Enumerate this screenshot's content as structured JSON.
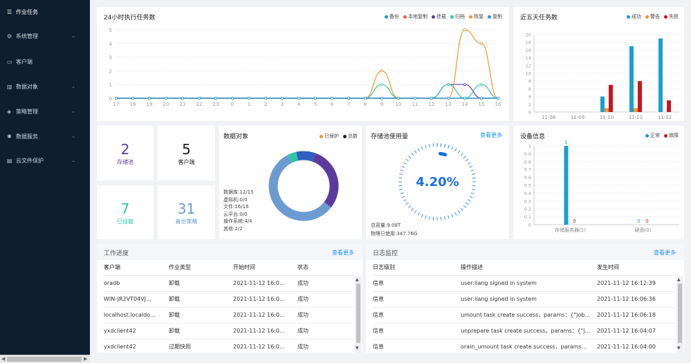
{
  "sidebar": {
    "items": [
      {
        "label": "作业任务",
        "icon": "list-icon"
      },
      {
        "label": "系统管理",
        "icon": "gear-icon"
      },
      {
        "label": "客户端",
        "icon": "monitor-icon"
      },
      {
        "label": "数据对象",
        "icon": "chart-icon"
      },
      {
        "label": "策略管理",
        "icon": "stack-icon"
      },
      {
        "label": "数据服务",
        "icon": "asterisk-icon"
      },
      {
        "label": "云文件保护",
        "icon": "document-icon"
      }
    ]
  },
  "tasks24h": {
    "title": "24小时执行任务数",
    "legend": [
      {
        "name": "备份",
        "color": "#1a9fcf"
      },
      {
        "name": "本地复制",
        "color": "#e5604b"
      },
      {
        "name": "挂载",
        "color": "#5b3c9e"
      },
      {
        "name": "归档",
        "color": "#2ec7a5"
      },
      {
        "name": "恢复",
        "color": "#f0962f"
      },
      {
        "name": "复制",
        "color": "#1f9dd9"
      }
    ]
  },
  "chart_data": [
    {
      "type": "line",
      "title": "24小时执行任务数",
      "x": [
        "17",
        "18",
        "19",
        "20",
        "21",
        "22",
        "23",
        "0",
        "1",
        "2",
        "3",
        "4",
        "5",
        "6",
        "7",
        "8",
        "9",
        "10",
        "11",
        "12",
        "13",
        "14",
        "15",
        "16"
      ],
      "ylim": [
        0,
        5
      ],
      "yticks": [
        0,
        1,
        2,
        3,
        4,
        5
      ],
      "grid": true,
      "legend_position": "top-right",
      "series": [
        {
          "name": "备份",
          "color": "#1a9fcf",
          "values": [
            0,
            0,
            0,
            0,
            0,
            0,
            0,
            0,
            0,
            0,
            0,
            0,
            0,
            0,
            0,
            0,
            0,
            0,
            0,
            0,
            0,
            0,
            0,
            0
          ]
        },
        {
          "name": "本地复制",
          "color": "#e5604b",
          "values": [
            0,
            0,
            0,
            0,
            0,
            0,
            0,
            0,
            0,
            0,
            0,
            0,
            0,
            0,
            0,
            0,
            0,
            0,
            0,
            0,
            0,
            0,
            0,
            0
          ]
        },
        {
          "name": "挂载",
          "color": "#5b3c9e",
          "values": [
            0,
            0,
            0,
            0,
            0,
            0,
            0,
            0,
            0,
            0,
            0,
            0,
            0,
            0,
            0,
            0,
            0,
            0,
            0,
            0,
            1,
            1,
            0,
            0
          ]
        },
        {
          "name": "归档",
          "color": "#2ec7a5",
          "values": [
            0,
            0,
            0,
            0,
            0,
            0,
            0,
            0,
            0,
            0,
            0,
            0,
            0,
            0,
            0,
            0,
            1,
            0,
            0,
            0,
            1,
            0,
            1,
            0
          ]
        },
        {
          "name": "恢复",
          "color": "#f0962f",
          "values": [
            0,
            0,
            0,
            0,
            0,
            0,
            0,
            0,
            0,
            0,
            0,
            0,
            0,
            0,
            0,
            0,
            2,
            0,
            0,
            0,
            0,
            5,
            4,
            0
          ]
        },
        {
          "name": "复制",
          "color": "#1f9dd9",
          "values": [
            0,
            0,
            0,
            0,
            0,
            0,
            0,
            0,
            0,
            0,
            0,
            0,
            0,
            0,
            0,
            0,
            0,
            0,
            0,
            0,
            0,
            0,
            0,
            0
          ]
        }
      ]
    },
    {
      "type": "bar",
      "title": "近五天任务数",
      "categories": [
        "11-08",
        "11-09",
        "11-10",
        "11-11",
        "11-12"
      ],
      "ylim": [
        0,
        20
      ],
      "yticks": [
        0,
        2,
        4,
        6,
        8,
        10,
        12,
        14,
        16,
        18,
        20
      ],
      "grid": true,
      "legend_position": "top-right",
      "series": [
        {
          "name": "成功",
          "color": "#1a9fcf",
          "values": [
            0,
            0,
            4,
            17,
            19
          ]
        },
        {
          "name": "警告",
          "color": "#f0962f",
          "values": [
            0,
            0,
            1,
            1,
            0
          ]
        },
        {
          "name": "失败",
          "color": "#c8161d",
          "values": [
            0,
            0,
            7,
            8,
            3
          ]
        }
      ]
    },
    {
      "type": "pie",
      "title": "数据对象",
      "legend_position": "top-right",
      "series": [
        {
          "name": "已保护",
          "color": "#f0962f",
          "values": [
            0
          ]
        },
        {
          "name": "总数",
          "color": "#222222",
          "values": [
            0
          ]
        }
      ],
      "slices": [
        {
          "color": "#5b3c9e",
          "value": 30
        },
        {
          "color": "#6c9bd2",
          "value": 57
        },
        {
          "color": "#2ec7a5",
          "value": 4
        },
        {
          "color": "#2f5fc0",
          "value": 9
        }
      ]
    },
    {
      "type": "bar",
      "title": "设备信息",
      "categories": [
        "存储服务器(1)",
        "硬盘(0)"
      ],
      "ylim": [
        0,
        1
      ],
      "yticks": [
        0,
        0.1,
        0.2,
        0.3,
        0.4,
        0.5,
        0.6,
        0.7,
        0.8,
        0.9,
        1
      ],
      "grid": true,
      "legend_position": "top-right",
      "series": [
        {
          "name": "正常",
          "color": "#1a9fcf",
          "values": [
            1,
            0
          ]
        },
        {
          "name": "故障",
          "color": "#c8161d",
          "values": [
            0,
            0
          ]
        }
      ]
    }
  ],
  "fiveDays": {
    "title": "近五天任务数",
    "legend": [
      {
        "name": "成功",
        "color": "#1a9fcf"
      },
      {
        "name": "警告",
        "color": "#f0962f"
      },
      {
        "name": "失败",
        "color": "#c8161d"
      }
    ]
  },
  "stats": [
    {
      "value": "2",
      "label": "存储池",
      "color": "#5b3c9e"
    },
    {
      "value": "5",
      "label": "客户端",
      "color": "#222222"
    },
    {
      "value": "7",
      "label": "已挂载",
      "color": "#2ec7a5"
    },
    {
      "value": "31",
      "label": "备份策略",
      "color": "#6c9bd2"
    }
  ],
  "dataObjects": {
    "title": "数据对象",
    "legend": [
      {
        "name": "已保护",
        "color": "#f0962f"
      },
      {
        "name": "总数",
        "color": "#222222"
      }
    ],
    "lines": [
      "数据库:12/15",
      "虚拟机:0/0",
      "文件:16/16",
      "云平台:0/0",
      "操作系统:4/4",
      "其他:2/2"
    ]
  },
  "storagePool": {
    "title": "存储池使用量",
    "more": "查看更多",
    "percent": "4.20%",
    "percent_value": 4.2,
    "total": "总容量:9.08T",
    "used": "物理已使用:347.76G"
  },
  "devices": {
    "title": "设备信息",
    "legend": [
      {
        "name": "正常",
        "color": "#1a9fcf"
      },
      {
        "name": "故障",
        "color": "#c8161d"
      }
    ],
    "labels": [
      "1",
      "0",
      "0",
      "0"
    ],
    "categories": [
      "存储服务器(1)",
      "硬盘(0)"
    ]
  },
  "work": {
    "title": "工作进度",
    "more": "查看更多",
    "columns": [
      "客户端",
      "作业类型",
      "开始时间",
      "状态"
    ],
    "rows": [
      [
        "oradb",
        "卸载",
        "2021-11-12 16:0...",
        "成功"
      ],
      [
        "WIN-JR2VT04VJ...",
        "卸载",
        "2021-11-12 16:0...",
        "成功"
      ],
      [
        "localhost.localdo...",
        "卸载",
        "2021-11-12 16:0...",
        "成功"
      ],
      [
        "yxdclient42",
        "卸载",
        "2021-11-12 16:0...",
        "成功"
      ],
      [
        "yxdclient42",
        "过期快照",
        "2021-11-12 16:0...",
        "成功"
      ]
    ]
  },
  "logs": {
    "title": "日志监控",
    "more": "查看更多",
    "columns": [
      "日志级别",
      "操作描述",
      "发生时间"
    ],
    "rows": [
      [
        "信息",
        "user:liang signed in system",
        "2021-11-12 16:12:39"
      ],
      [
        "信息",
        "user:liang signed in system",
        "2021-11-12 16:06:36"
      ],
      [
        "信息",
        "umount task create success，params：{\"job...",
        "2021-11-12 16:06:18"
      ],
      [
        "信息",
        "unprepare task create success，params：{\"j...",
        "2021-11-12 16:04:07"
      ],
      [
        "信息",
        "orain_umount task create success，params...",
        "2021-11-12 16:04:00"
      ]
    ]
  }
}
